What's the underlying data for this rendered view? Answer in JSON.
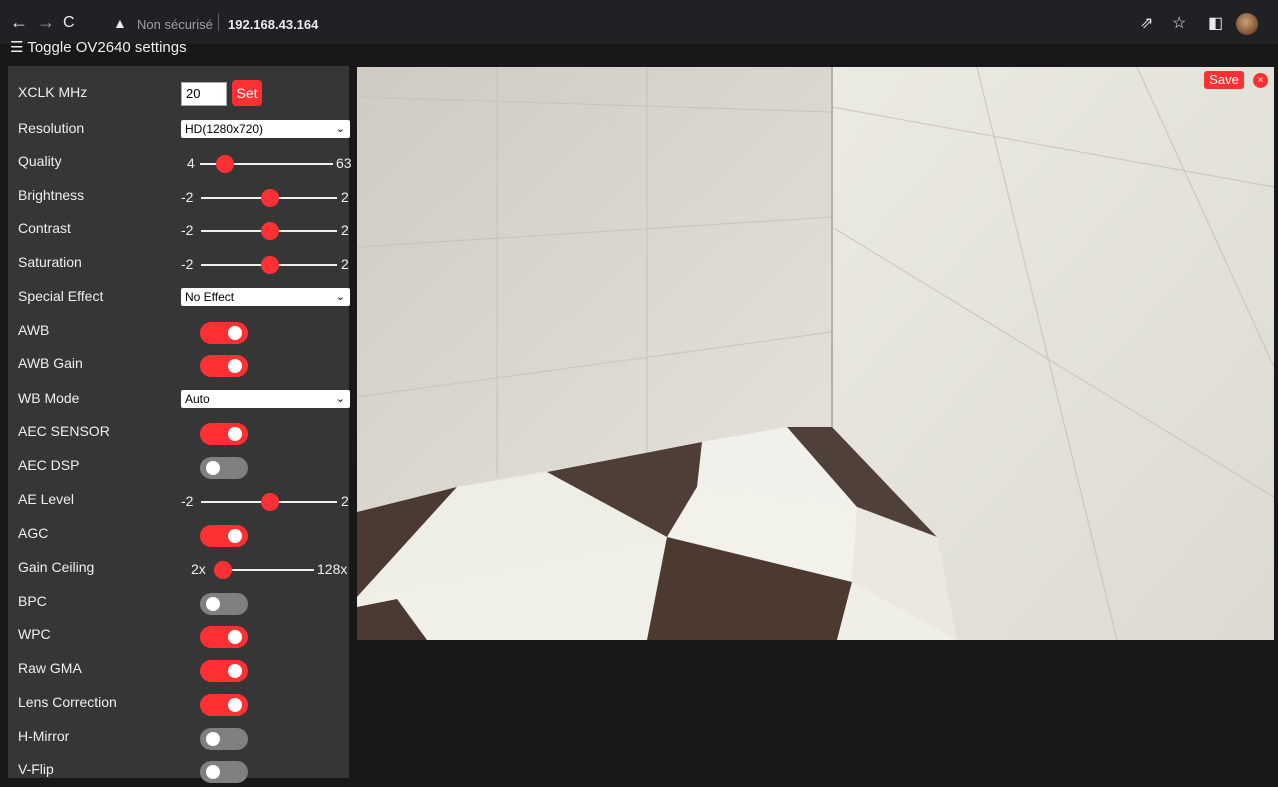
{
  "browser": {
    "address_warning": "Non sécurisé",
    "url": "192.168.43.164"
  },
  "page": {
    "toggle_label": "Toggle OV2640 settings"
  },
  "settings": {
    "xclk": {
      "label": "XCLK MHz",
      "value": "20",
      "button": "Set"
    },
    "resolution": {
      "label": "Resolution",
      "value": "HD(1280x720)"
    },
    "quality": {
      "label": "Quality",
      "min": "4",
      "max": "63",
      "value": 10
    },
    "brightness": {
      "label": "Brightness",
      "min": "-2",
      "max": "2",
      "value": 0
    },
    "contrast": {
      "label": "Contrast",
      "min": "-2",
      "max": "2",
      "value": 0
    },
    "saturation": {
      "label": "Saturation",
      "min": "-2",
      "max": "2",
      "value": 0
    },
    "special_effect": {
      "label": "Special Effect",
      "value": "No Effect"
    },
    "awb": {
      "label": "AWB",
      "on": true
    },
    "awb_gain": {
      "label": "AWB Gain",
      "on": true
    },
    "wb_mode": {
      "label": "WB Mode",
      "value": "Auto"
    },
    "aec_sensor": {
      "label": "AEC SENSOR",
      "on": true
    },
    "aec_dsp": {
      "label": "AEC DSP",
      "on": false
    },
    "ae_level": {
      "label": "AE Level",
      "min": "-2",
      "max": "2",
      "value": 0
    },
    "agc": {
      "label": "AGC",
      "on": true
    },
    "gain_ceiling": {
      "label": "Gain Ceiling",
      "min": "2x",
      "max": "128x",
      "value": 0
    },
    "bpc": {
      "label": "BPC",
      "on": false
    },
    "wpc": {
      "label": "WPC",
      "on": true
    },
    "raw_gma": {
      "label": "Raw GMA",
      "on": true
    },
    "lens_correction": {
      "label": "Lens Correction",
      "on": true
    },
    "h_mirror": {
      "label": "H-Mirror",
      "on": false
    },
    "v_flip": {
      "label": "V-Flip",
      "on": false
    }
  },
  "stream": {
    "save_label": "Save",
    "close_label": "×"
  },
  "colors": {
    "accent": "#ff3034",
    "panel": "#363636",
    "background": "#181818"
  }
}
